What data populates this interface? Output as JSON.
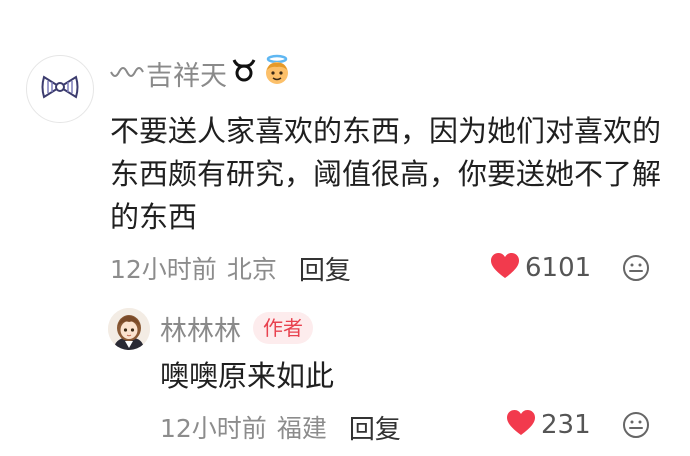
{
  "comment": {
    "username": "吉祥天",
    "username_prefix_icon": "wavy-line-icon",
    "username_suffix_icons": [
      "taurus-symbol-icon",
      "angel-emoji-icon"
    ],
    "avatar_icon": "bow-icon",
    "text": "不要送人家喜欢的东西，因为她们对喜欢的东西颇有研究，阈值很高，你要送她不了解的东西",
    "time": "12小时前",
    "location": "北京",
    "reply_label": "回复",
    "like_count": "6101",
    "like_icon": "heart-icon",
    "reaction_icon": "emoji-face-icon"
  },
  "reply": {
    "username": "林林林",
    "author_badge": "作者",
    "avatar_icon": "anime-girl-avatar",
    "text": "噢噢原来如此",
    "time": "12小时前",
    "location": "福建",
    "reply_label": "回复",
    "like_count": "231",
    "like_icon": "heart-icon",
    "reaction_icon": "emoji-face-icon"
  },
  "colors": {
    "heart": "#f23a4d",
    "meta_text": "#8c8c8c",
    "badge_bg": "#fdeced",
    "badge_text": "#e8424f"
  }
}
